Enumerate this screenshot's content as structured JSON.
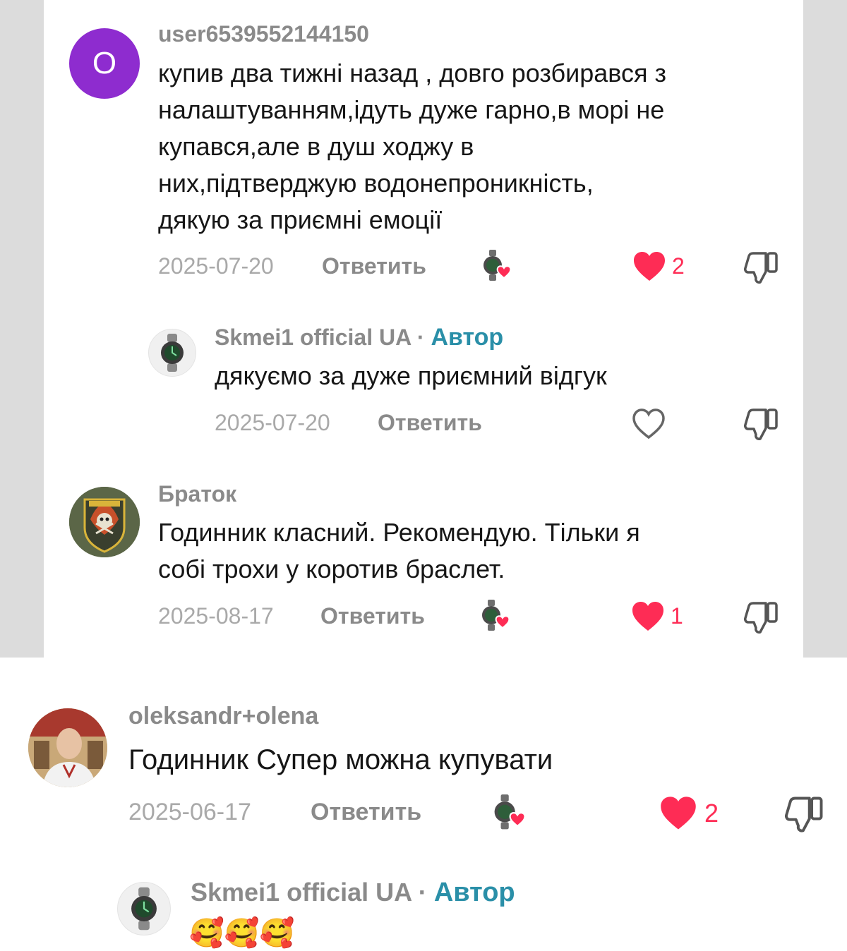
{
  "colors": {
    "like_red": "#fe2c55",
    "author_badge": "#2a8fa8",
    "avatar_purple": "#8e2ccf"
  },
  "comments": [
    {
      "avatar_letter": "O",
      "username": "user6539552144150",
      "lines": [
        "купив два тижні назад , довго розбирався з",
        "налаштуванням,ідуть дуже гарно,в морі не",
        "купався,але в душ ходжу в",
        "них,підтверджую водонепроникність,",
        "дякую за приємні емоції"
      ],
      "date": "2025-07-20",
      "reply_label": "Ответить",
      "likes": "2",
      "liked": true,
      "reply": {
        "username": "Skmei1 official UA",
        "separator": "·",
        "author_label": "Автор",
        "text": "дякуємо за дуже приємний відгук",
        "date": "2025-07-20",
        "reply_label": "Ответить",
        "liked": false
      }
    },
    {
      "username": "Браток",
      "lines": [
        "Годинник класний. Рекомендую. Тільки я",
        "собі трохи у коротив браслет."
      ],
      "date": "2025-08-17",
      "reply_label": "Ответить",
      "likes": "1",
      "liked": true
    },
    {
      "username": "oleksandr+olena",
      "lines": [
        "Годинник Супер можна купувати"
      ],
      "date": "2025-06-17",
      "reply_label": "Ответить",
      "likes": "2",
      "liked": true,
      "reply": {
        "username": "Skmei1 official UA",
        "separator": "·",
        "author_label": "Автор",
        "text": "🥰🥰🥰"
      }
    }
  ],
  "icons": {
    "like": "heart-icon",
    "dislike": "thumbs-down-icon",
    "creator_liked": "creator-liked-icon",
    "author_avatar": "watch-avatar"
  }
}
